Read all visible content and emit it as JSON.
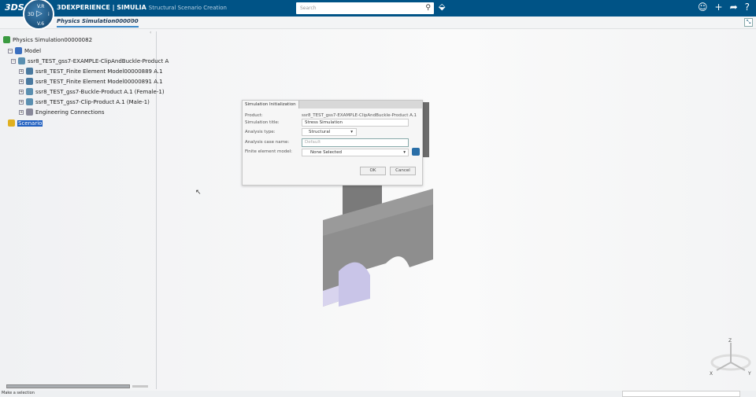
{
  "header": {
    "logo": "3DS",
    "brand_bold": "3DEXPERIENCE | SIMULIA",
    "brand_sub": "Structural Scenario Creation",
    "compass": {
      "top": "V.R",
      "left": "3D",
      "right": "i",
      "bottom": "V.6"
    },
    "search_placeholder": "Search",
    "icons": [
      "search-icon",
      "tag-icon",
      "user-icon",
      "plus-icon",
      "share-icon",
      "help-icon"
    ]
  },
  "tabs": [
    {
      "label": "Physics Simulation000000"
    }
  ],
  "tree": {
    "root": "Physics Simulation00000082",
    "model": "Model",
    "product": "ssr8_TEST_gss7-EXAMPLE-ClipAndBuckle-Product A",
    "children": [
      "ssr8_TEST_Finite Element Model00000889 A.1",
      "ssr8_TEST_Finite Element Model00000891 A.1",
      "ssr8_TEST_gss7-Buckle-Product A.1 (Female-1)",
      "ssr8_TEST_gss7-Clip-Product A.1 (Male-1)",
      "Engineering Connections"
    ],
    "scenario": "Scenario"
  },
  "dialog": {
    "title": "Simulation Initialization",
    "product_label": "Product:",
    "product_value": "ssr8_TEST_gss7-EXAMPLE-ClipAndBuckle-Product A.1",
    "title_label": "Simulation title:",
    "title_value": "Stress Simulation",
    "type_label": "Analysis type:",
    "type_value": "Structural",
    "case_label": "Analysis case name:",
    "case_placeholder": "Default",
    "fem_label": "Finite element model:",
    "fem_value": "None Selected",
    "ok": "OK",
    "cancel": "Cancel"
  },
  "compass3d": {
    "x": "X",
    "y": "Y",
    "z": "Z"
  },
  "status": "Make a selection"
}
